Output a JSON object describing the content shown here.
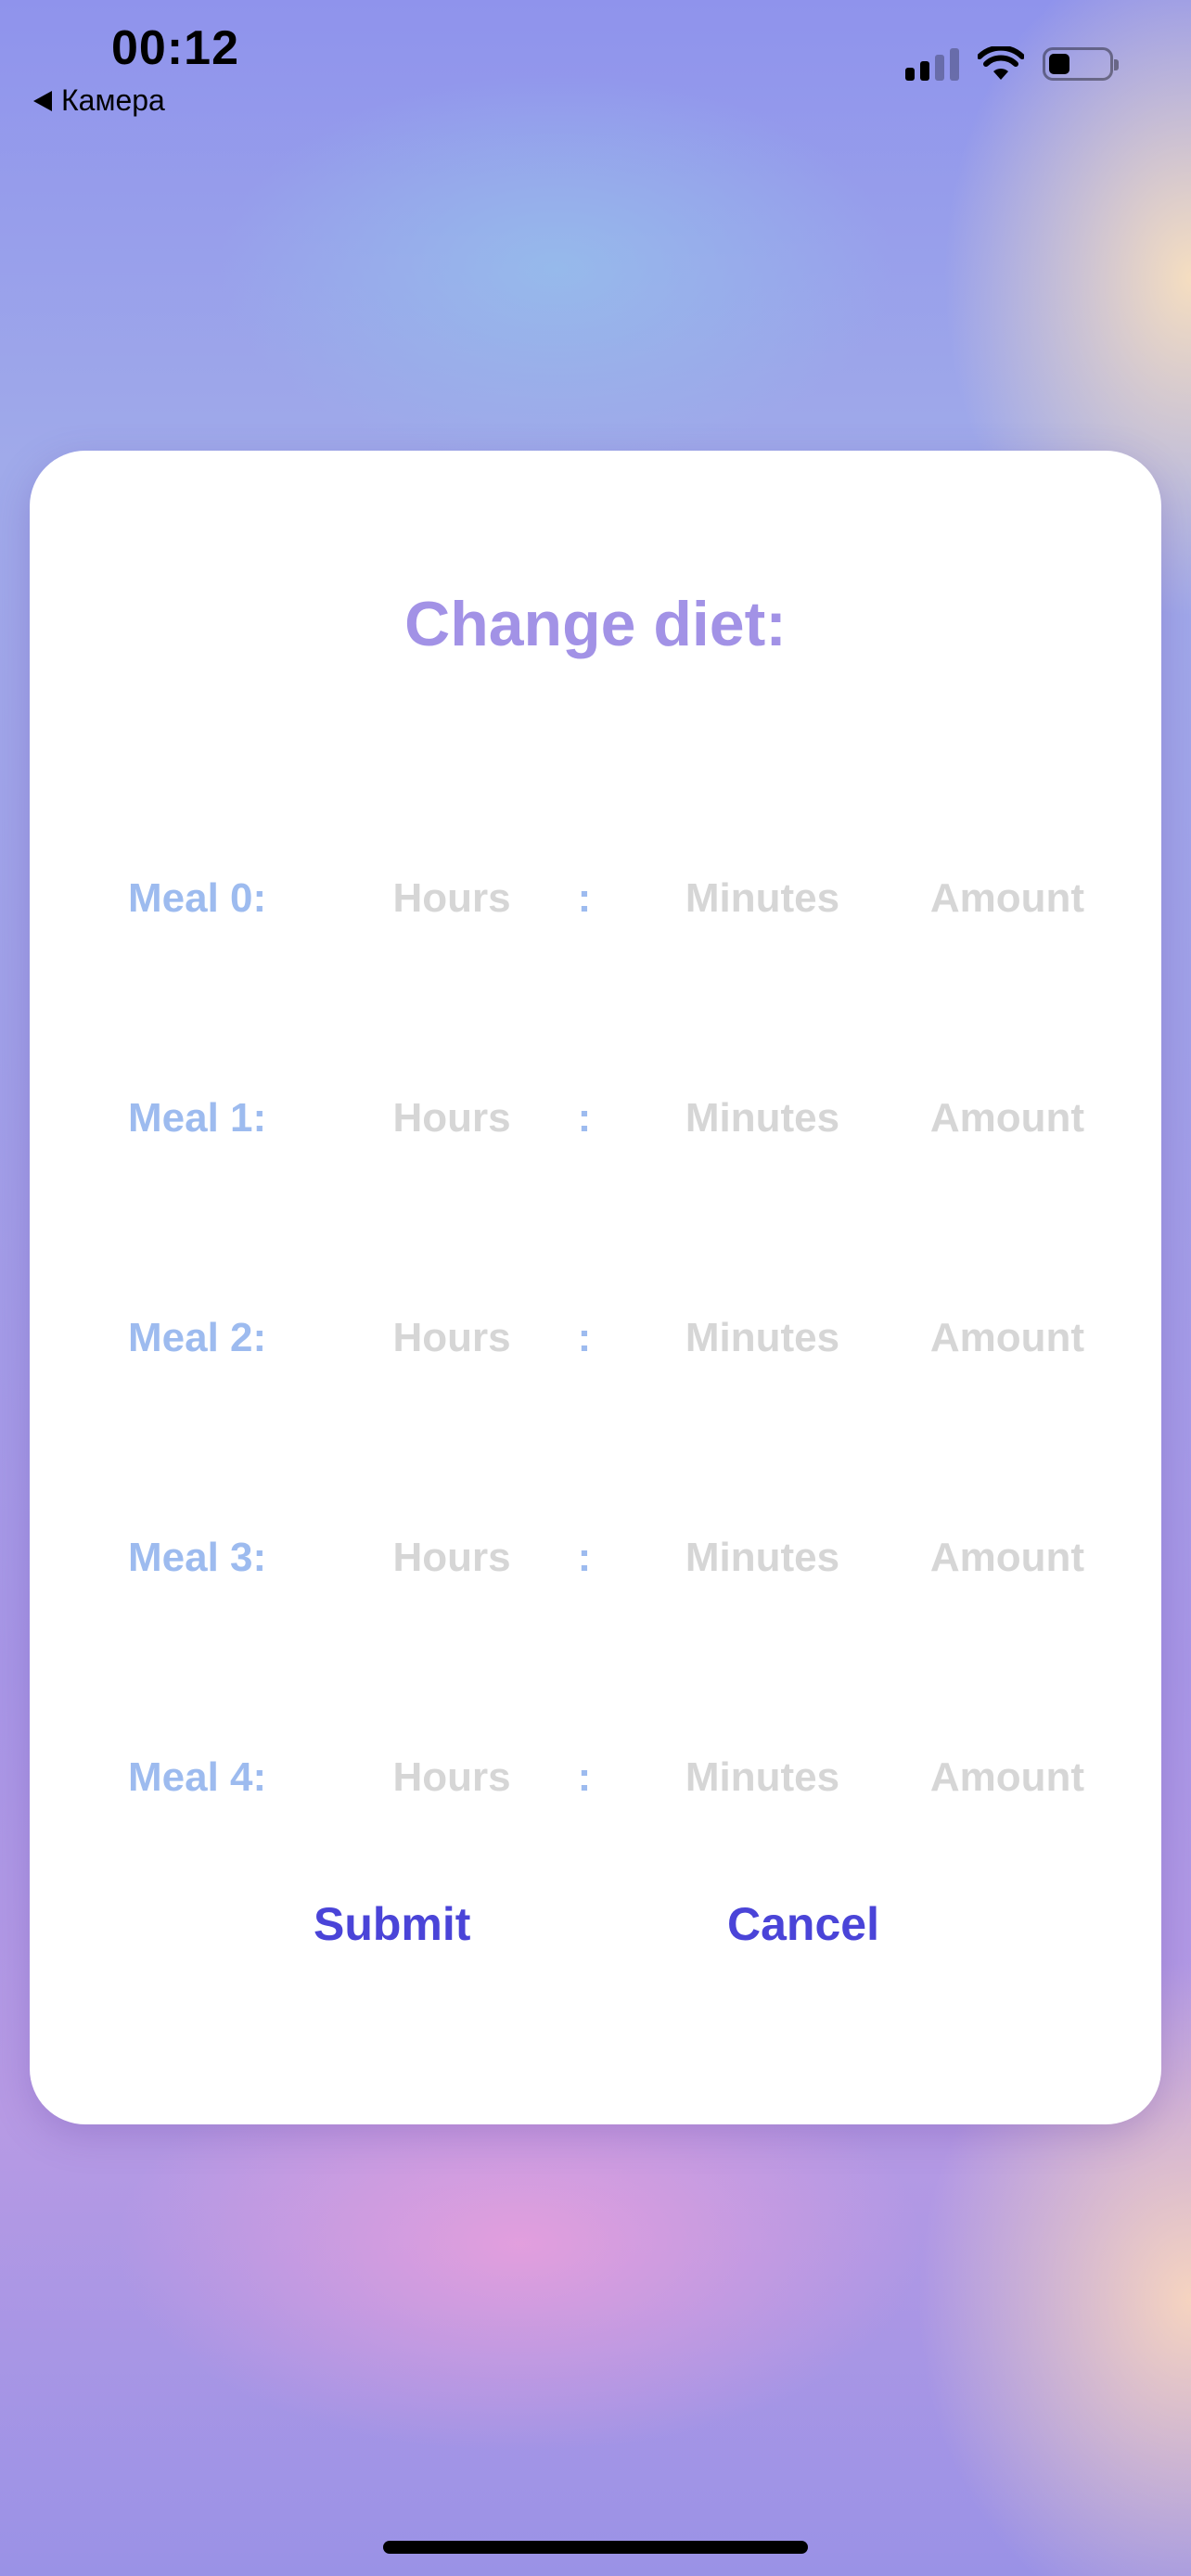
{
  "status_bar": {
    "time": "00:12",
    "back_label": "Камера",
    "back_icon": "back-triangle-icon",
    "icons": [
      "cellular-signal-icon",
      "wifi-icon",
      "battery-icon"
    ],
    "battery_level": 0.35,
    "signal_bars_active": 2,
    "signal_bars_total": 4
  },
  "modal": {
    "title": "Change diet:",
    "meals": [
      {
        "label": "Meal 0:",
        "hours_placeholder": "Hours",
        "separator": ":",
        "minutes_placeholder": "Minutes",
        "amount_placeholder": "Amount"
      },
      {
        "label": "Meal 1:",
        "hours_placeholder": "Hours",
        "separator": ":",
        "minutes_placeholder": "Minutes",
        "amount_placeholder": "Amount"
      },
      {
        "label": "Meal 2:",
        "hours_placeholder": "Hours",
        "separator": ":",
        "minutes_placeholder": "Minutes",
        "amount_placeholder": "Amount"
      },
      {
        "label": "Meal 3:",
        "hours_placeholder": "Hours",
        "separator": ":",
        "minutes_placeholder": "Minutes",
        "amount_placeholder": "Amount"
      },
      {
        "label": "Meal 4:",
        "hours_placeholder": "Hours",
        "separator": ":",
        "minutes_placeholder": "Minutes",
        "amount_placeholder": "Amount"
      }
    ],
    "submit_label": "Submit",
    "cancel_label": "Cancel"
  },
  "colors": {
    "title": "#a292e6",
    "meal_label": "#9dbbef",
    "placeholder": "#d6d6d6",
    "button": "#4a44d8"
  }
}
